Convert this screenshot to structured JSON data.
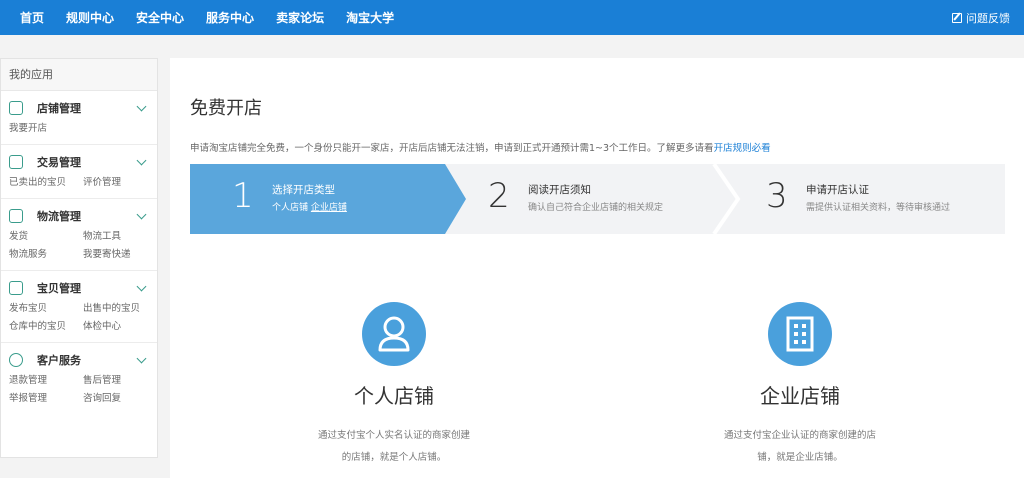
{
  "topnav": {
    "items": [
      "首页",
      "规则中心",
      "安全中心",
      "服务中心",
      "卖家论坛",
      "淘宝大学"
    ],
    "feedback": "问题反馈"
  },
  "sidebar": {
    "title": "我的应用",
    "groups": [
      {
        "title": "店铺管理",
        "icon": "shop-icon",
        "links": [
          "我要开店"
        ]
      },
      {
        "title": "交易管理",
        "icon": "trade-icon",
        "links": [
          "已卖出的宝贝",
          "评价管理"
        ]
      },
      {
        "title": "物流管理",
        "icon": "truck-icon",
        "links": [
          "发货",
          "物流工具",
          "物流服务",
          "我要寄快递"
        ]
      },
      {
        "title": "宝贝管理",
        "icon": "tshirt-icon",
        "links": [
          "发布宝贝",
          "出售中的宝贝",
          "仓库中的宝贝",
          "体检中心"
        ]
      },
      {
        "title": "客户服务",
        "icon": "service-icon",
        "links": [
          "退款管理",
          "售后管理",
          "举报管理",
          "咨询回复"
        ]
      }
    ]
  },
  "main": {
    "title": "免费开店",
    "notice_text": "申请淘宝店铺完全免费，一个身份只能开一家店，开店后店铺无法注销，申请到正式开通预计需1~3个工作日。了解更多请看",
    "notice_link": "开店规则必看",
    "steps": [
      {
        "num": "1",
        "title": "选择开店类型",
        "desc_a": "个人店铺",
        "desc_b": "企业店铺"
      },
      {
        "num": "2",
        "title": "阅读开店须知",
        "desc": "确认自己符合企业店铺的相关规定"
      },
      {
        "num": "3",
        "title": "申请开店认证",
        "desc": "需提供认证相关资料，等待审核通过"
      }
    ],
    "shops": [
      {
        "name": "个人店铺",
        "desc1": "通过支付宝个人实名认证的商家创建",
        "desc2": "的店铺，就是个人店铺。"
      },
      {
        "name": "企业店铺",
        "desc1": "通过支付宝企业认证的商家创建的店",
        "desc2": "铺，就是企业店铺。"
      }
    ]
  },
  "colors": {
    "nav_blue": "#1a7fd6",
    "step_active": "#5aa6dc",
    "icon_blue": "#4aa0dc",
    "sidebar_icon": "#3a9c8c"
  }
}
